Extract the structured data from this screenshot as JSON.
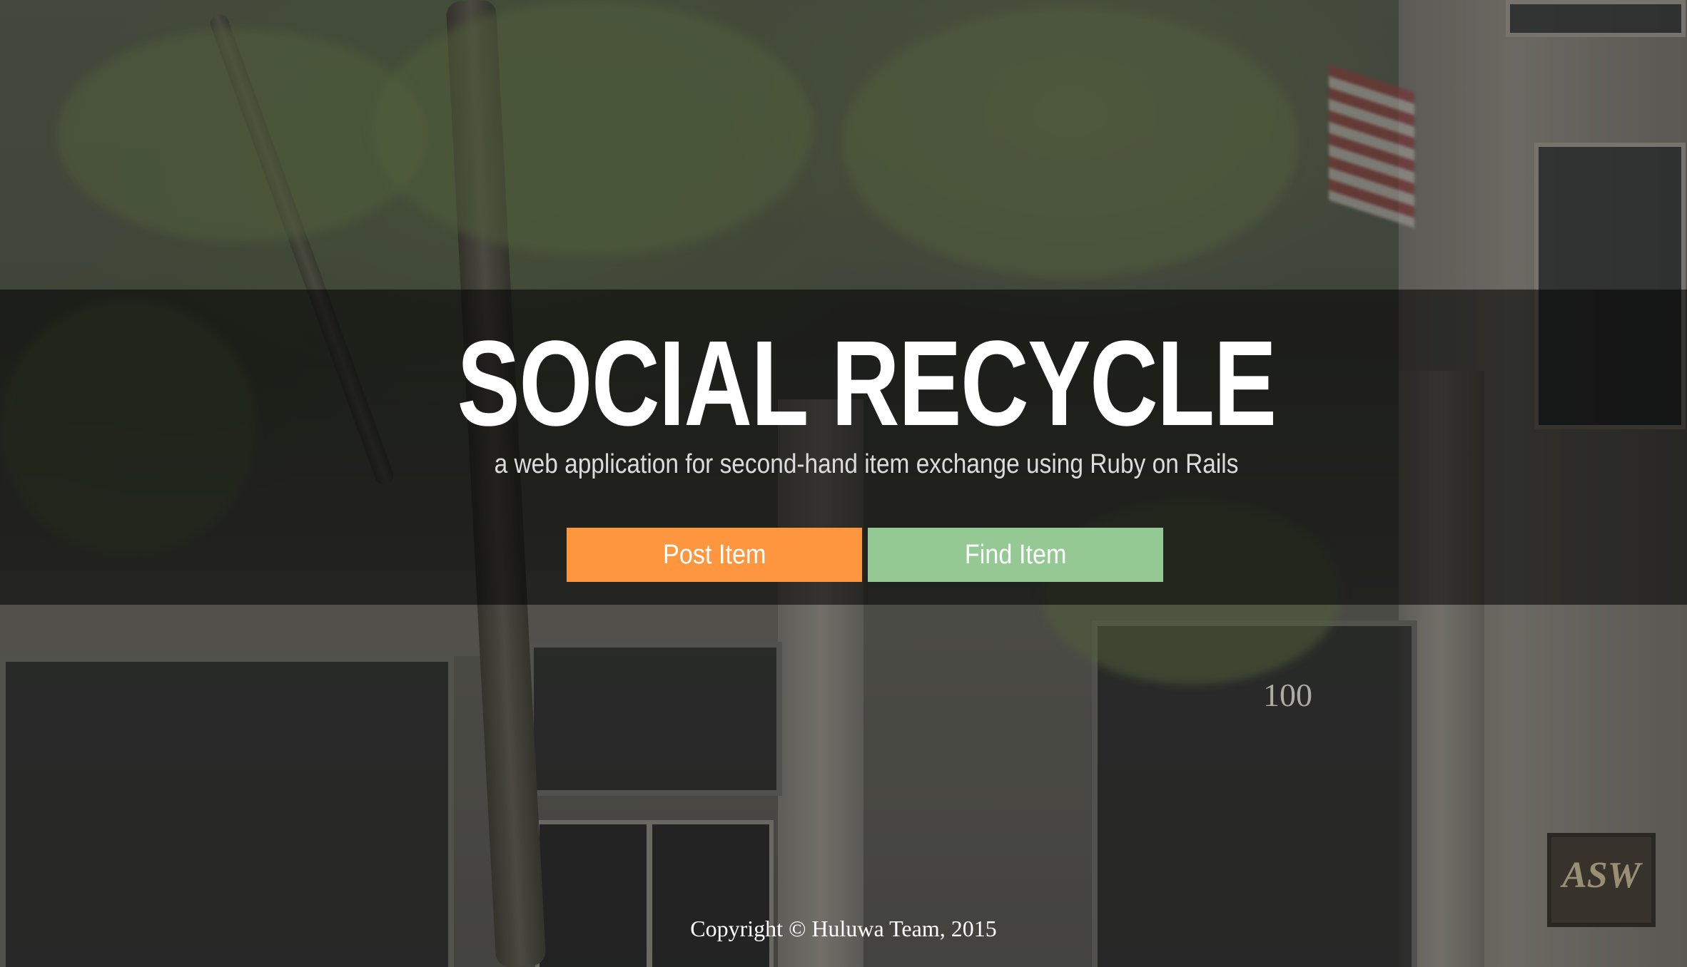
{
  "hero": {
    "title": "SOCIAL RECYCLE",
    "subtitle": "a web application for second-hand item exchange using Ruby on Rails"
  },
  "actions": {
    "post_label": "Post Item",
    "find_label": "Find Item"
  },
  "footer": {
    "copyright": "Copyright © Huluwa Team, 2015"
  },
  "background": {
    "building_number": "100",
    "plaque_text": "ASW"
  },
  "colors": {
    "post_button": "#fd963f",
    "find_button": "#94c994",
    "overlay": "rgba(0,0,0,0.55)"
  }
}
